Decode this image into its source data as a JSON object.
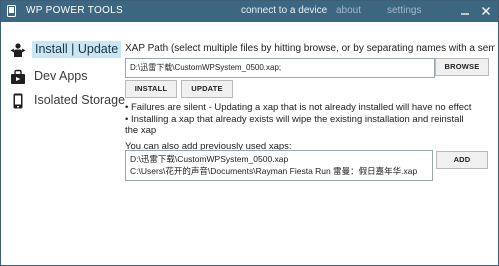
{
  "window": {
    "title": "WP POWER TOOLS",
    "nav": {
      "connect": "connect to a device",
      "about": "about",
      "settings": "settings"
    },
    "accent_color": "#3d6781"
  },
  "sidebar": {
    "items": [
      {
        "label": "Install | Update",
        "icon": "install-icon",
        "selected": true
      },
      {
        "label": "Dev Apps",
        "icon": "dev-apps-icon",
        "selected": false
      },
      {
        "label": "Isolated Storage",
        "icon": "phone-icon",
        "selected": false
      }
    ]
  },
  "main": {
    "xap_label": "XAP Path (select multiple files by hitting browse, or by separating names with a semi-colo",
    "path_value": "D:\\迅雷下载\\CustomWPSystem_0500.xap;",
    "browse_label": "BROWSE",
    "install_label": "INSTALL",
    "update_label": "UPDATE",
    "note_1": "• Failures are silent - Updating a xap that is not already installed will have no effect",
    "note_2": "• Installing a xap that already exists will wipe the existing installation and reinstall",
    "note_2_cont": "the xap",
    "previous_label": "You can also add previously used xaps:",
    "previous_items": [
      "D:\\迅雷下载\\CustomWPSystem_0500.xap",
      "C:\\Users\\花开的声音\\Documents\\Rayman Fiesta Run 雷曼：假日嘉年华.xap"
    ],
    "add_label": "ADD"
  }
}
